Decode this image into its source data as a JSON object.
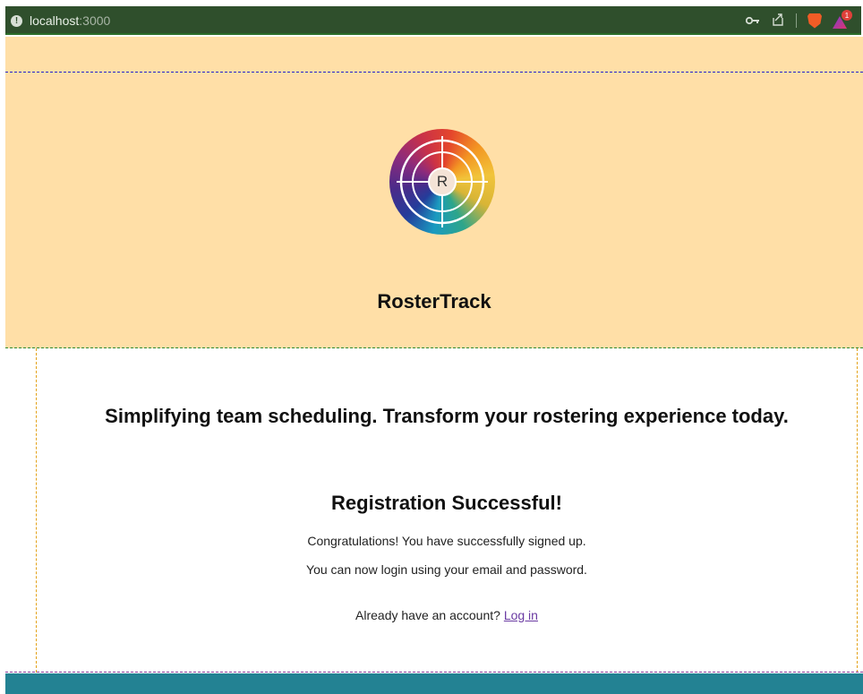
{
  "browser": {
    "url_host": "localhost",
    "url_port": ":3000",
    "icons": [
      "info-icon",
      "key-icon",
      "share-icon",
      "brave-shields-icon",
      "brave-rewards-icon"
    ],
    "rewards_badge": "1"
  },
  "header": {
    "logo_letter": "R",
    "brand_name": "RosterTrack"
  },
  "main": {
    "tagline": "Simplifying team scheduling. Transform your rostering experience today.",
    "success_title": "Registration Successful!",
    "message_1": "Congratulations! You have successfully signed up.",
    "message_2": "You can now login using your email and password.",
    "login_prompt": "Already have an account?",
    "login_link": "Log in"
  },
  "colors": {
    "header_bg": "#ffdfa7",
    "footer_bg": "#238293",
    "link": "#6a3aa2"
  }
}
